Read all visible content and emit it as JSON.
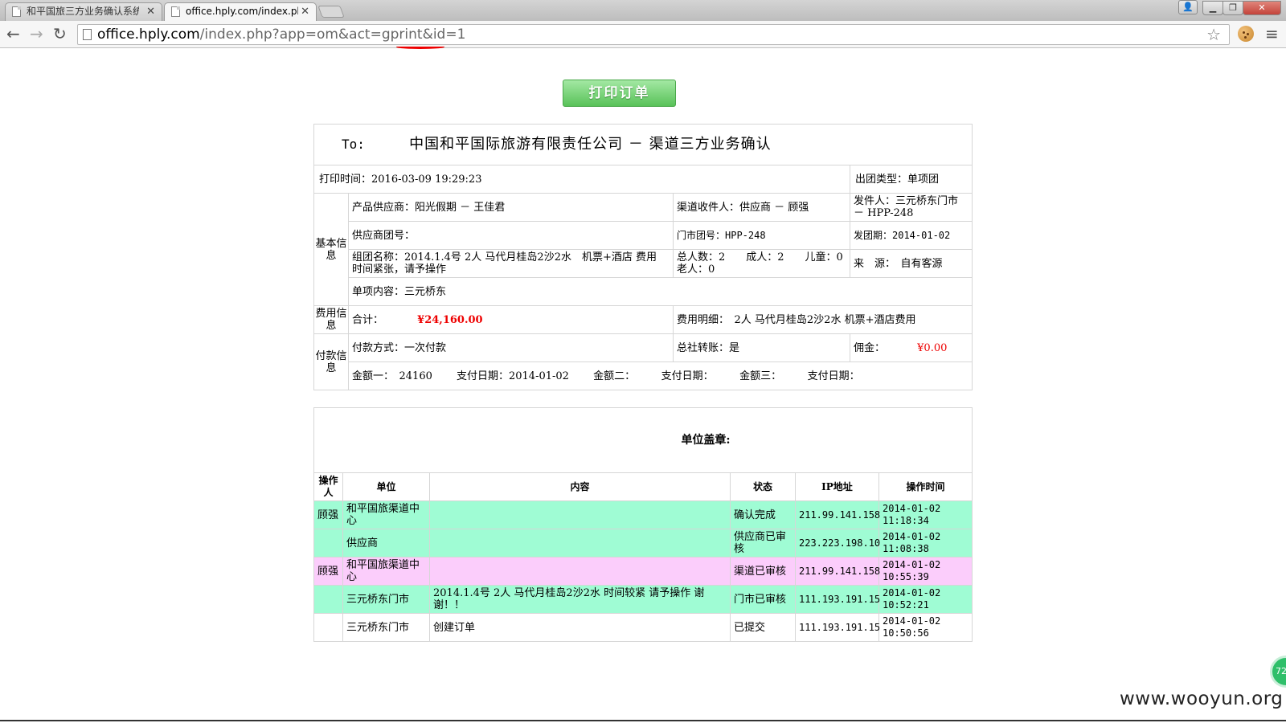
{
  "browser": {
    "tabs": [
      {
        "title": "和平国旅三方业务确认系统",
        "active": false
      },
      {
        "title": "office.hply.com/index.php",
        "active": true
      }
    ],
    "url_host": "office.hply.com",
    "url_path": "/index.php?app=om&act=gprint&id=1"
  },
  "print_button": "打印订单",
  "doc": {
    "to_label": "To:",
    "title": "中国和平国际旅游有限责任公司 － 渠道三方业务确认",
    "print_time": "打印时间：2016-03-09 19:29:23",
    "tour_type": "出团类型：单项团",
    "basic_label": "基本信息",
    "supplier": "产品供应商：阳光假期 － 王佳君",
    "channel_receiver": "渠道收件人：供应商 － 顾强",
    "sender": "发件人：三元桥东门市 － HPP-248",
    "supplier_group_no": "供应商团号：",
    "store_group_no": "门市团号：HPP-248",
    "departure": "发团期：2014-01-02",
    "group_name": "组团名称：2014.1.4号 2人 马代月桂岛2沙2水　机票+酒店 费用　　时间紧张，请予操作",
    "headcount": "总人数：2　　成人：2　　儿童：0　　老人：0",
    "source": "来　源：　自有客源",
    "single_content": "单项内容：三元桥东",
    "fee_label": "费用信息",
    "total_label": "合计：",
    "total_value": "¥24,160.00",
    "fee_detail": "费用明细：　2人 马代月桂岛2沙2水 机票+酒店费用",
    "pay_label": "付款信息",
    "pay_method": "付款方式：一次付款",
    "hq_transfer": "总社转账：是",
    "commission_label": "佣金：",
    "commission_value": "¥0.00",
    "amounts": "金额一：　24160　　 支付日期：2014-01-02　　 金额二：　　　支付日期：　　　金额三：　　　支付日期："
  },
  "stamp_label": "单位盖章:",
  "log": {
    "headers": [
      "操作人",
      "单位",
      "内容",
      "状态",
      "IP地址",
      "操作时间"
    ],
    "rows": [
      {
        "operator": "顾强",
        "unit": "和平国旅渠道中心",
        "content": "",
        "status": "确认完成",
        "ip": "211.99.141.158",
        "time": "2014-01-02 11:18:34"
      },
      {
        "operator": "",
        "unit": "供应商",
        "content": "",
        "status": "供应商已审核",
        "ip": "223.223.198.10",
        "time": "2014-01-02 11:08:38"
      },
      {
        "operator": "顾强",
        "unit": "和平国旅渠道中心",
        "content": "",
        "status": "渠道已审核",
        "ip": "211.99.141.158",
        "time": "2014-01-02 10:55:39"
      },
      {
        "operator": "",
        "unit": "三元桥东门市",
        "content": "2014.1.4号 2人 马代月桂岛2沙2水 时间较紧 请予操作 谢谢！！",
        "status": "门市已审核",
        "ip": "111.193.191.15",
        "time": "2014-01-02 10:52:21"
      },
      {
        "operator": "",
        "unit": "三元桥东门市",
        "content": "创建订单",
        "status": "已提交",
        "ip": "111.193.191.15",
        "time": "2014-01-02 10:50:56"
      }
    ]
  },
  "watermark": "www.wooyun.org",
  "badge": "72"
}
